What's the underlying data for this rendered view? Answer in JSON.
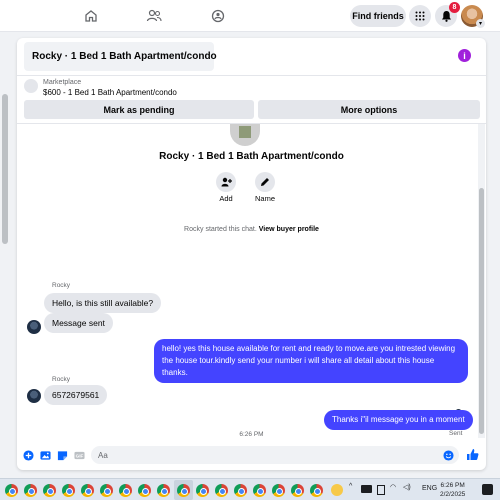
{
  "nav": {
    "find_friends": "Find friends",
    "notifications_count": "8"
  },
  "listing_header": {
    "title": "Rocky · 1 Bed 1 Bath Apartment/condo"
  },
  "marketplace": {
    "label": "Marketplace",
    "price_title": "$600 - 1 Bed 1 Bath Apartment/condo"
  },
  "actions": {
    "mark_pending": "Mark as pending",
    "more_options": "More options"
  },
  "profile_card": {
    "title": "Rocky · 1 Bed 1 Bath Apartment/condo",
    "add_label": "Add",
    "name_label": "Name"
  },
  "chat_started": {
    "text": "Rocky started this chat.",
    "link": "View buyer profile"
  },
  "messages": {
    "m1_sender": "Rocky",
    "m1_text": "Hello, is this still available?",
    "m2_text": "Message sent",
    "m3_text": "hello! yes this house available for rent and ready to move.are you intrested viewing the house tour.kindly send your number i will share all detail about this house thanks.",
    "m4_sender": "Rocky",
    "m4_text": "6572679561",
    "time": "6:26 PM",
    "m5_text": "Thanks i\"il message you in a moment",
    "status": "Sent"
  },
  "composer": {
    "placeholder": "Aa"
  },
  "taskbar": {
    "lang": "ENG",
    "time": "6:26 PM",
    "date": "2/2/2025"
  },
  "colors": {
    "accent": "#0866ff",
    "outgoing_bubble": "#4444ff",
    "badge": "#e41e3f"
  }
}
